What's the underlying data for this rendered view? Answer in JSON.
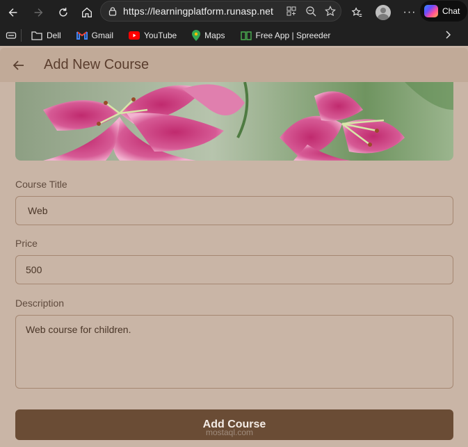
{
  "browser": {
    "url": "https://learningplatform.runasp.net",
    "chat_label": "Chat",
    "bookmarks": [
      {
        "label": "Dell",
        "icon": "folder-icon"
      },
      {
        "label": "Gmail",
        "icon": "gmail-icon"
      },
      {
        "label": "YouTube",
        "icon": "youtube-icon"
      },
      {
        "label": "Maps",
        "icon": "maps-icon"
      },
      {
        "label": "Free App | Spreeder",
        "icon": "book-icon"
      }
    ]
  },
  "page": {
    "title": "Add New Course",
    "hero_image": "pink stargazer lily flowers"
  },
  "form": {
    "title_label": "Course Title",
    "title_value": "Web",
    "price_label": "Price",
    "price_value": "500",
    "description_label": "Description",
    "description_value": "Web course for children.",
    "submit_label": "Add Course"
  },
  "watermark": "mostaql.com",
  "colors": {
    "background": "#c9b5a6",
    "header": "#c1aa98",
    "accent": "#6a4c35",
    "field_border": "#a58772"
  }
}
